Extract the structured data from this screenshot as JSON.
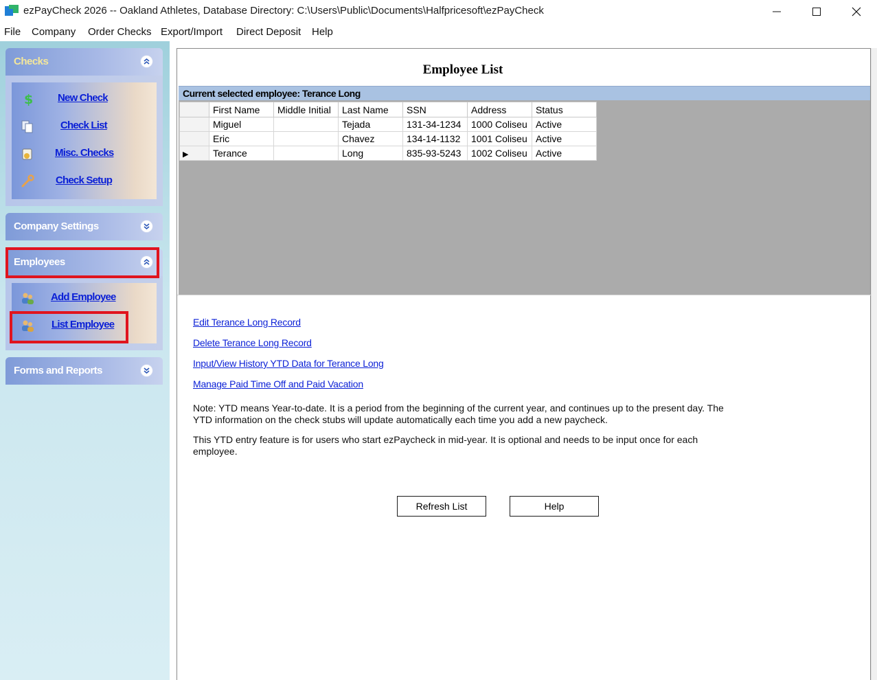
{
  "window": {
    "title": "ezPayCheck 2026 -- Oakland Athletes, Database Directory: C:\\Users\\Public\\Documents\\Halfpricesoft\\ezPayCheck"
  },
  "menu": [
    "File",
    "Company",
    "Order Checks",
    "Export/Import",
    "Direct Deposit",
    "Help"
  ],
  "sidebar": {
    "checks": {
      "title": "Checks",
      "items": [
        "New Check",
        "Check List",
        "Misc. Checks",
        "Check Setup"
      ]
    },
    "company_settings": {
      "title": "Company Settings"
    },
    "employees": {
      "title": "Employees",
      "items": [
        "Add Employee",
        "List Employee"
      ]
    },
    "forms_reports": {
      "title": "Forms and Reports"
    }
  },
  "main": {
    "title": "Employee List",
    "selected_label": "Current selected employee:  Terance Long",
    "columns": [
      "First Name",
      "Middle Initial",
      "Last Name",
      "SSN",
      "Address",
      "Status"
    ],
    "rows": [
      [
        "Miguel",
        "",
        "Tejada",
        "131-34-1234",
        "1000 Coliseu",
        "Active"
      ],
      [
        "Eric",
        "",
        "Chavez",
        "134-14-1132",
        "1001 Coliseu",
        "Active"
      ],
      [
        "Terance",
        "",
        "Long",
        "835-93-5243",
        "1002 Coliseu",
        "Active"
      ]
    ],
    "current_row_marker": "▶",
    "links": {
      "edit": "Edit Terance Long Record",
      "delete": "Delete Terance Long Record",
      "ytd": "Input/View History YTD Data for Terance Long",
      "pto": "Manage Paid Time Off and Paid Vacation"
    },
    "note1": "Note: YTD means Year-to-date. It is a period from the beginning of the current year, and continues up to the present day. The YTD information on the check stubs will update automatically each time you add a new paycheck.",
    "note2": "This YTD entry feature is for users who start ezPaycheck in mid-year. It is optional and needs to be input once for each employee.",
    "buttons": {
      "refresh": "Refresh List",
      "help": "Help"
    }
  }
}
